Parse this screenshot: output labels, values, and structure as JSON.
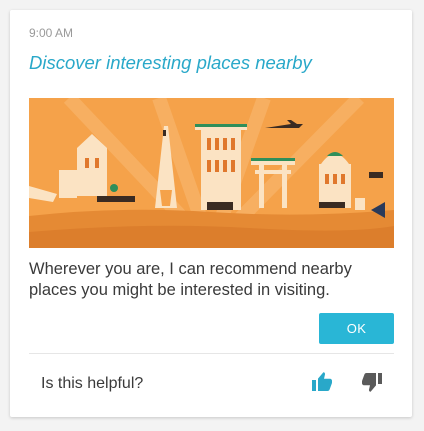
{
  "card": {
    "time": "9:00 AM",
    "title": "Discover interesting places nearby",
    "body": "Wherever you are, I can recommend nearby places you might be interested in visiting.",
    "ok_label": "OK"
  },
  "feedback": {
    "question": "Is this helpful?",
    "thumb_up_icon": "thumbs-up-icon",
    "thumb_down_icon": "thumbs-down-icon"
  },
  "colors": {
    "accent": "#29a8c9",
    "button": "#29b6d6",
    "illustration_bg": "#f5a24a"
  }
}
